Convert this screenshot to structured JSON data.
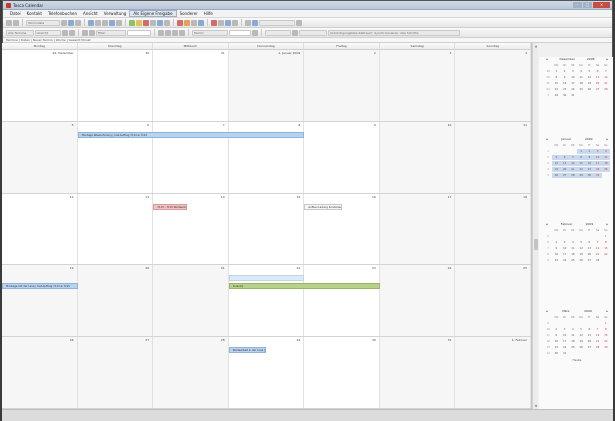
{
  "window": {
    "title": "Tosca Calendar"
  },
  "menu": [
    "Datei",
    "Kontakt",
    "Telefonbuchen",
    "Ansicht",
    "Verwaltung",
    "Als Eigene Freigabe",
    "Sonderer",
    "Hilfe"
  ],
  "menu_active_index": 5,
  "toolbar1": {
    "field": "Terminliste"
  },
  "toolbar2": {
    "field1": "Alle Termine",
    "field2": "Ansicht",
    "field3": "Filter",
    "field4": "Termin",
    "label_right": "Ankündigungsliste Zeitraum: Synchronisieren: Alle Schritte"
  },
  "pathbar": "Termine | Daten | Neuer Termin | Woche | Gesamt Monat",
  "day_headers": [
    "Montag",
    "Dienstag",
    "Mittwoch",
    "Donnerstag",
    "Freitag",
    "Samstag",
    "Sonntag"
  ],
  "weeks": [
    {
      "days": [
        "29. Dezember",
        "30",
        "31",
        "1. Januar 2009",
        "2",
        "3",
        "4"
      ],
      "events": []
    },
    {
      "days": [
        "5",
        "6",
        "7",
        "8",
        "9",
        "10",
        "11"
      ],
      "events": [
        {
          "text": "Montage Wiederholung | Inst.Auftrag 7113 & 7115",
          "style": "blue",
          "start": 1,
          "span": 3
        }
      ]
    },
    {
      "days": [
        "12",
        "13",
        "14",
        "15",
        "16",
        "17",
        "18"
      ],
      "events": [
        {
          "text": "7113 - 7115 Wartearbeiten",
          "style": "pink",
          "start": 2,
          "span": 0.45
        },
        {
          "text": "Aufbau Ladung Kundenweit 0150",
          "style": "white",
          "start": 4,
          "span": 0.5
        }
      ]
    },
    {
      "days": [
        "19",
        "20",
        "21",
        "22",
        "23",
        "24",
        "25"
      ],
      "events": [
        {
          "text": "",
          "style": "pale",
          "start": 3,
          "span": 1,
          "row": 0
        },
        {
          "text": "Inventur",
          "style": "green",
          "start": 3,
          "span": 2,
          "row": 1
        },
        {
          "text": "Montage mit der Linie | Inst.Auftrag 7113 & 7215",
          "style": "blue",
          "start": 0,
          "span": 1,
          "row": 1
        }
      ]
    },
    {
      "days": [
        "26",
        "27",
        "28",
        "29",
        "30",
        "31",
        "1. Februar"
      ],
      "events": [
        {
          "text": "Wartearbeit in der Linie | 7155M",
          "style": "blue",
          "start": 3,
          "span": 0.5
        }
      ]
    }
  ],
  "minicals": [
    {
      "month": "Dezember",
      "year": "2008",
      "dow": [
        "Mo",
        "Di",
        "Mi",
        "Do",
        "Fr",
        "Sa",
        "So"
      ],
      "rows": [
        [
          "49",
          "1",
          "2",
          "3",
          "4",
          "5",
          "6",
          "7"
        ],
        [
          "50",
          "8",
          "9",
          "10",
          "11",
          "12",
          "13",
          "14"
        ],
        [
          "51",
          "15",
          "16",
          "17",
          "18",
          "19",
          "20",
          "21"
        ],
        [
          "52",
          "22",
          "23",
          "24",
          "25",
          "26",
          "27",
          "28"
        ],
        [
          "1",
          "29",
          "30",
          "31",
          "",
          "",
          "",
          ""
        ]
      ]
    },
    {
      "month": "Januar",
      "year": "2009",
      "dow": [
        "Mo",
        "Di",
        "Mi",
        "Do",
        "Fr",
        "Sa",
        "So"
      ],
      "rows": [
        [
          "1",
          "",
          "",
          "",
          "1",
          "2",
          "3",
          "4"
        ],
        [
          "2",
          "5",
          "6",
          "7",
          "8",
          "9",
          "10",
          "11"
        ],
        [
          "3",
          "12",
          "13",
          "14",
          "15",
          "16",
          "17",
          "18"
        ],
        [
          "4",
          "19",
          "20",
          "21",
          "22",
          "23",
          "24",
          "25"
        ],
        [
          "5",
          "26",
          "27",
          "28",
          "29",
          "30",
          "31",
          ""
        ]
      ]
    },
    {
      "month": "Februar",
      "year": "2009",
      "dow": [
        "Mo",
        "Di",
        "Mi",
        "Do",
        "Fr",
        "Sa",
        "So"
      ],
      "rows": [
        [
          "5",
          "",
          "",
          "",
          "",
          "",
          "",
          "1"
        ],
        [
          "6",
          "2",
          "3",
          "4",
          "5",
          "6",
          "7",
          "8"
        ],
        [
          "7",
          "9",
          "10",
          "11",
          "12",
          "13",
          "14",
          "15"
        ],
        [
          "8",
          "16",
          "17",
          "18",
          "19",
          "20",
          "21",
          "22"
        ],
        [
          "9",
          "23",
          "24",
          "25",
          "26",
          "27",
          "28",
          ""
        ]
      ]
    },
    {
      "month": "März",
      "year": "2009",
      "dow": [
        "Mo",
        "Di",
        "Mi",
        "Do",
        "Fr",
        "Sa",
        "So"
      ],
      "rows": [
        [
          "9",
          "",
          "",
          "",
          "",
          "",
          "",
          "1"
        ],
        [
          "10",
          "2",
          "3",
          "4",
          "5",
          "6",
          "7",
          "8"
        ],
        [
          "11",
          "9",
          "10",
          "11",
          "12",
          "13",
          "14",
          "15"
        ],
        [
          "12",
          "16",
          "17",
          "18",
          "19",
          "20",
          "21",
          "22"
        ],
        [
          "13",
          "23",
          "24",
          "25",
          "26",
          "27",
          "28",
          "29"
        ],
        [
          "14",
          "30",
          "31",
          "",
          "",
          "",
          "",
          ""
        ]
      ]
    }
  ],
  "today_label": "Heute"
}
